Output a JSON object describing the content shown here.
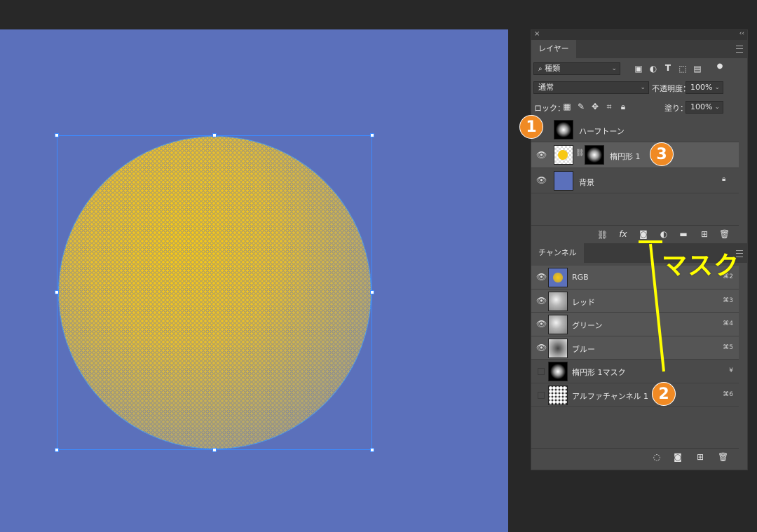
{
  "layers_panel": {
    "tab": "レイヤー",
    "filter_kind": "種類",
    "blend_mode": "通常",
    "opacity_label": "不透明度：",
    "opacity_value": "100%",
    "lock_label": "ロック：",
    "fill_label": "塗り：",
    "fill_value": "100%",
    "layers": [
      {
        "name": "ハーフトーン",
        "visible": false
      },
      {
        "name": "楕円形 1",
        "visible": true
      },
      {
        "name": "背景",
        "visible": true,
        "locked": true
      }
    ]
  },
  "channels_panel": {
    "tab": "チャンネル",
    "channels": [
      {
        "name": "RGB",
        "shortcut": "⌘2",
        "visible": true
      },
      {
        "name": "レッド",
        "shortcut": "⌘3",
        "visible": true
      },
      {
        "name": "グリーン",
        "shortcut": "⌘4",
        "visible": true
      },
      {
        "name": "ブルー",
        "shortcut": "⌘5",
        "visible": true
      },
      {
        "name": "楕円形 1マスク",
        "shortcut": "¥",
        "visible": false
      },
      {
        "name": "アルファチャンネル 1",
        "shortcut": "⌘6",
        "visible": false
      }
    ]
  },
  "annotations": {
    "badge_1": "1",
    "badge_2": "2",
    "badge_3": "3",
    "mask_label": "マスク",
    "badge_color": "#f08a24",
    "line_color": "#ffff00"
  },
  "colors": {
    "canvas": "#5b70bb",
    "circle_fill": "#f7c815",
    "selection": "#3d8bff"
  }
}
